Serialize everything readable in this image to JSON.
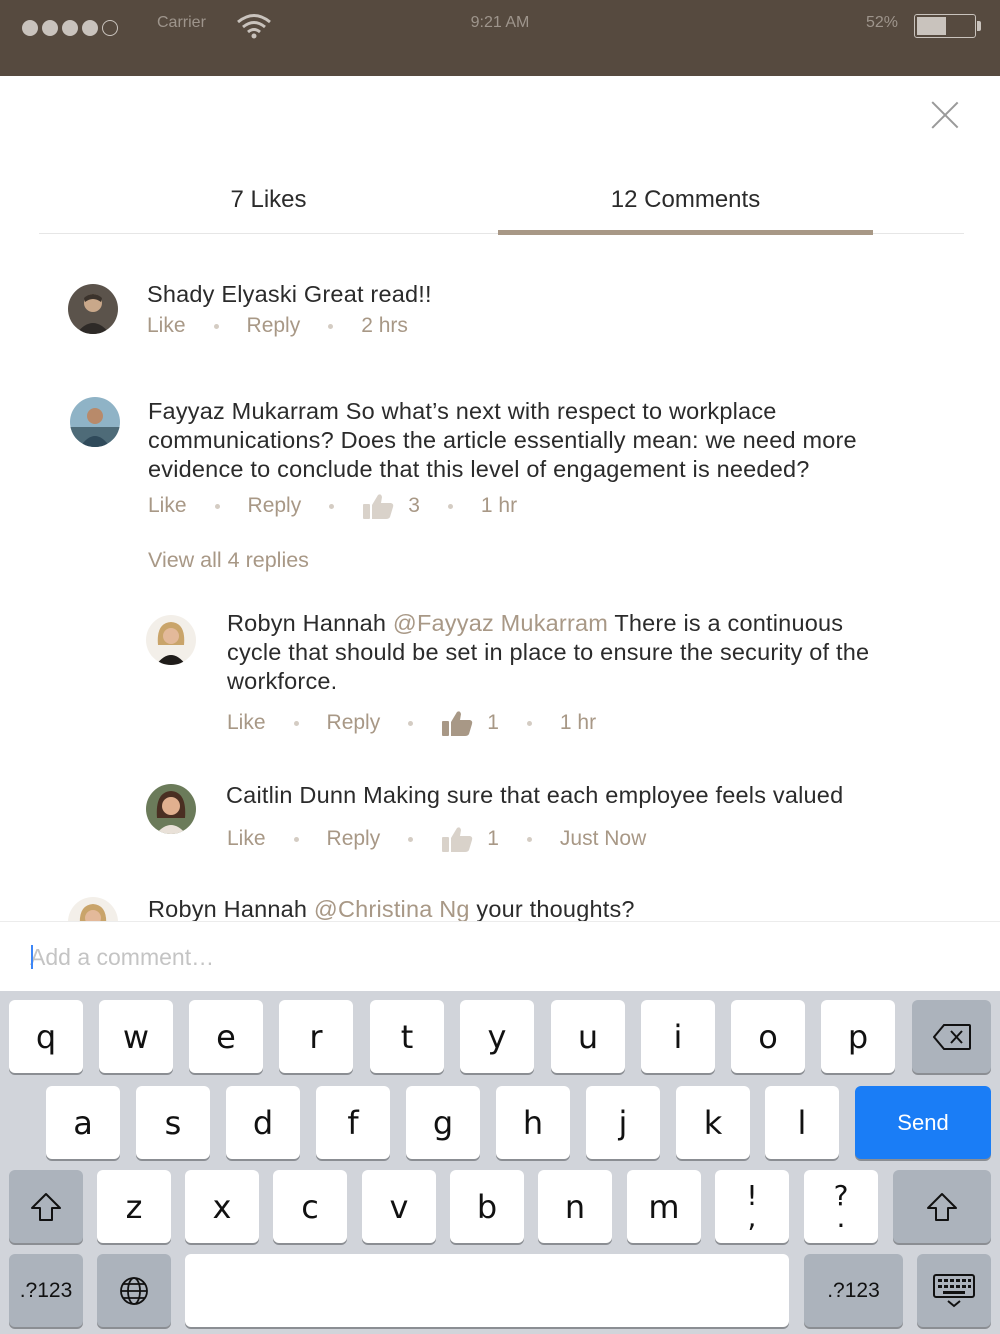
{
  "status": {
    "carrier": "Carrier",
    "time": "9:21 AM",
    "battery": "52%",
    "battery_level": 0.52
  },
  "tabs": {
    "likes": "7 Likes",
    "comments": "12 Comments"
  },
  "comments": [
    {
      "author": "Shady Elyaski",
      "text": " Great read!!",
      "like": "Like",
      "reply": "Reply",
      "time": "2 hrs"
    },
    {
      "author": "Fayyaz Mukarram",
      "text": " So what’s next with respect to workplace communications? Does the article essentially mean: we need more evidence to conclude that this level of engagement is needed?",
      "like": "Like",
      "reply": "Reply",
      "likes_count": "3",
      "time": "1 hr"
    },
    {
      "author": "Robyn Hannah",
      "mention": "@Fayyaz Mukarram",
      "text": " There is a continuous cycle that should be set in place to ensure the security of the workforce.",
      "like": "Like",
      "reply": "Reply",
      "likes_count": "1",
      "time": "1 hr"
    },
    {
      "author": "Caitlin Dunn",
      "text": " Making sure that each employee feels valued",
      "like": "Like",
      "reply": "Reply",
      "likes_count": "1",
      "time": "Just Now"
    },
    {
      "author": "Robyn Hannah",
      "mention": "@Christina Ng",
      "text": " your thoughts?"
    }
  ],
  "view_all_replies": "View all 4 replies",
  "comment_input": {
    "placeholder": "Add a comment…"
  },
  "keyboard": {
    "row1": [
      "q",
      "w",
      "e",
      "r",
      "t",
      "y",
      "u",
      "i",
      "o",
      "p"
    ],
    "row2": [
      "a",
      "s",
      "d",
      "f",
      "g",
      "h",
      "j",
      "k",
      "l"
    ],
    "row3": [
      "z",
      "x",
      "c",
      "v",
      "b",
      "n",
      "m"
    ],
    "send": "Send",
    "numbers": ".?123",
    "exclaim_top": "!",
    "exclaim_bottom": ",",
    "question_top": "?",
    "question_bottom": "."
  },
  "colors": {
    "status_bar": "#564a3f",
    "accent": "#a89886",
    "send": "#1a7df6"
  }
}
